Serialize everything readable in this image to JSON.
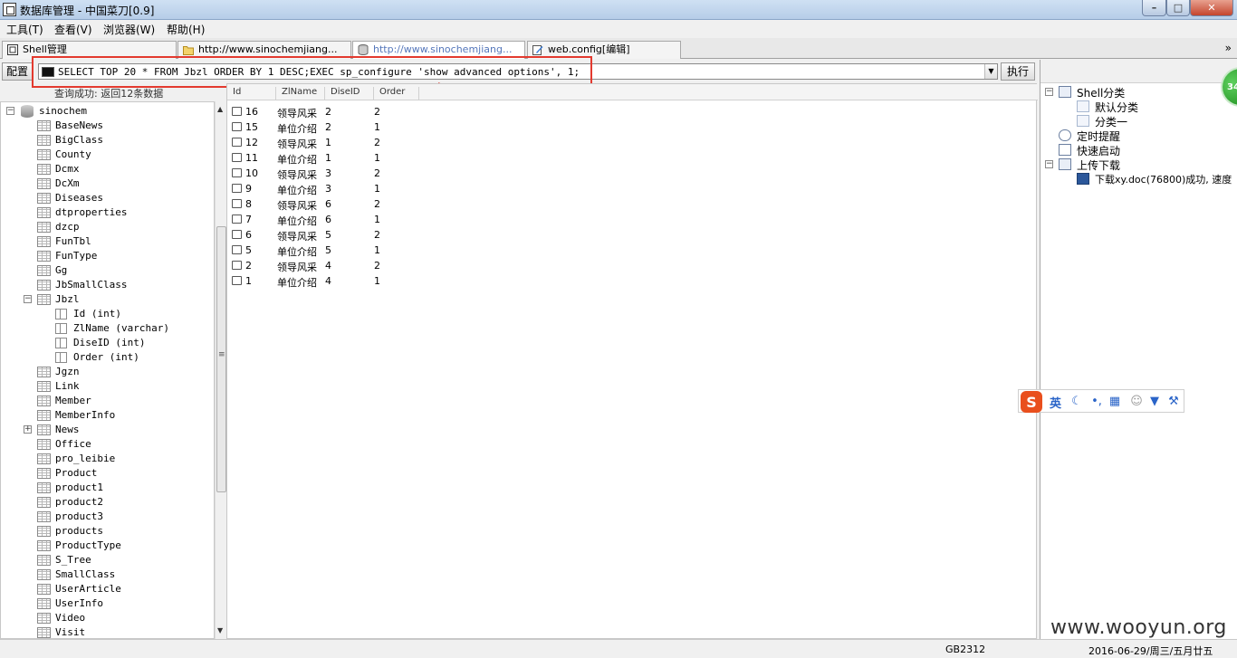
{
  "window": {
    "title": "数据库管理 - 中国菜刀[0.9]"
  },
  "menu": [
    "工具(T)",
    "查看(V)",
    "浏览器(W)",
    "帮助(H)"
  ],
  "tabs": [
    {
      "label": "Shell管理",
      "icon": "shell-icon"
    },
    {
      "label": "http://www.sinochemjiang...",
      "icon": "folder-icon"
    },
    {
      "label": "http://www.sinochemjiang...",
      "icon": "database-icon",
      "active": true
    },
    {
      "label": "web.config[编辑]",
      "icon": "edit-icon"
    }
  ],
  "tabs_more": "»",
  "toolbar": {
    "config_label": "配置",
    "sql": "SELECT TOP 20 * FROM Jbzl ORDER BY 1 DESC;EXEC sp_configure 'show advanced options', 1;",
    "exec_label": "执行",
    "status": "查询成功: 返回12条数据"
  },
  "tree": {
    "database": "sinochem",
    "tables": [
      "BaseNews",
      "BigClass",
      "County",
      "Dcmx",
      "DcXm",
      "Diseases",
      "dtproperties",
      "dzcp",
      "FunTbl",
      "FunType",
      "Gg",
      "JbSmallClass",
      "Jbzl",
      "Jgzn",
      "Link",
      "Member",
      "MemberInfo",
      "News",
      "Office",
      "pro_leibie",
      "Product",
      "product1",
      "product2",
      "product3",
      "products",
      "ProductType",
      "S_Tree",
      "SmallClass",
      "UserArticle",
      "UserInfo",
      "Video",
      "Visit"
    ],
    "expanded_table": "Jbzl",
    "columns": [
      "Id (int)",
      "ZlName (varchar)",
      "DiseID (int)",
      "Order (int)"
    ]
  },
  "grid": {
    "columns": [
      "Id",
      "ZlName",
      "DiseID",
      "Order"
    ],
    "rows": [
      [
        "16",
        "领导风采",
        "2",
        "2"
      ],
      [
        "15",
        "单位介绍",
        "2",
        "1"
      ],
      [
        "12",
        "领导风采",
        "1",
        "2"
      ],
      [
        "11",
        "单位介绍",
        "1",
        "1"
      ],
      [
        "10",
        "领导风采",
        "3",
        "2"
      ],
      [
        "9",
        "单位介绍",
        "3",
        "1"
      ],
      [
        "8",
        "领导风采",
        "6",
        "2"
      ],
      [
        "7",
        "单位介绍",
        "6",
        "1"
      ],
      [
        "6",
        "领导风采",
        "5",
        "2"
      ],
      [
        "5",
        "单位介绍",
        "5",
        "1"
      ],
      [
        "2",
        "领导风采",
        "4",
        "2"
      ],
      [
        "1",
        "单位介绍",
        "4",
        "1"
      ]
    ]
  },
  "right_panel": {
    "shell_category": "Shell分类",
    "default_category": "默认分类",
    "category_one": "分类一",
    "timer": "定时提醒",
    "quick_start": "快速启动",
    "upload_download": "上传下载",
    "download_item": "下载xy.doc(76800)成功, 速度"
  },
  "badge": "34",
  "ime": {
    "mode": "英"
  },
  "status_bar": {
    "encoding": "GB2312",
    "date": "2016-06-29/周三/五月廿五"
  },
  "watermark": "www.wooyun.org",
  "colors": {
    "highlight": "#e33a2f",
    "active_tab_text": "#5577bb",
    "ime_blue": "#2a64c8"
  }
}
